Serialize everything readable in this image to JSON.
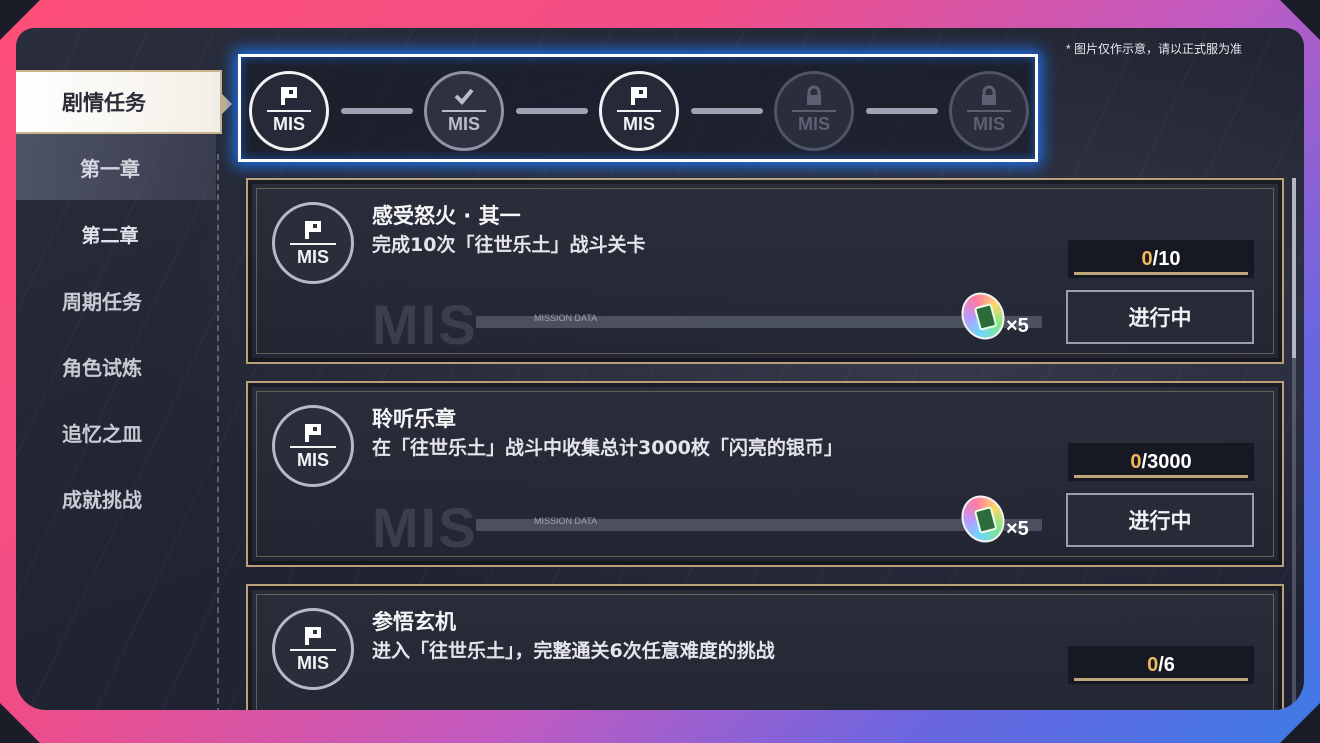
{
  "notice": "* 图片仅作示意，请以正式服为准",
  "sidebar": {
    "active_label": "剧情任务",
    "items": [
      {
        "label": "第一章"
      },
      {
        "label": "第二章"
      },
      {
        "label": "周期任务"
      },
      {
        "label": "角色试炼"
      },
      {
        "label": "追忆之皿"
      },
      {
        "label": "成就挑战"
      }
    ]
  },
  "mission_track": {
    "nodes": [
      {
        "label": "MIS",
        "state": "active",
        "icon": "mission-flag-icon"
      },
      {
        "label": "MIS",
        "state": "done",
        "icon": "checkmark-icon"
      },
      {
        "label": "MIS",
        "state": "active",
        "icon": "mission-flag-icon"
      },
      {
        "label": "MIS",
        "state": "locked",
        "icon": "lock-icon"
      },
      {
        "label": "MIS",
        "state": "locked",
        "icon": "lock-icon"
      }
    ]
  },
  "missions": [
    {
      "icon_label": "MIS",
      "title": "感受怒火 · 其一",
      "description": "完成10次「往世乐土」战斗关卡",
      "watermark": "MIS",
      "bar_label": "MISSION DATA",
      "reward_qty": "×5",
      "progress_current": "0",
      "progress_total": "/10",
      "status": "进行中"
    },
    {
      "icon_label": "MIS",
      "title": "聆听乐章",
      "description": "在「往世乐土」战斗中收集总计3000枚「闪亮的银币」",
      "watermark": "MIS",
      "bar_label": "MISSION DATA",
      "reward_qty": "×5",
      "progress_current": "0",
      "progress_total": "/3000",
      "status": "进行中"
    },
    {
      "icon_label": "MIS",
      "title": "参悟玄机",
      "description": "进入「往世乐土」，完整通关6次任意难度的挑战",
      "progress_current": "0",
      "progress_total": "/6"
    }
  ],
  "colors": {
    "frame_pink": "#ff4f7a",
    "frame_blue": "#3e7be6",
    "card_border_gold": "#b8a17a",
    "progress_orange": "#f0b85a",
    "track_glow": "#1e78ff"
  }
}
